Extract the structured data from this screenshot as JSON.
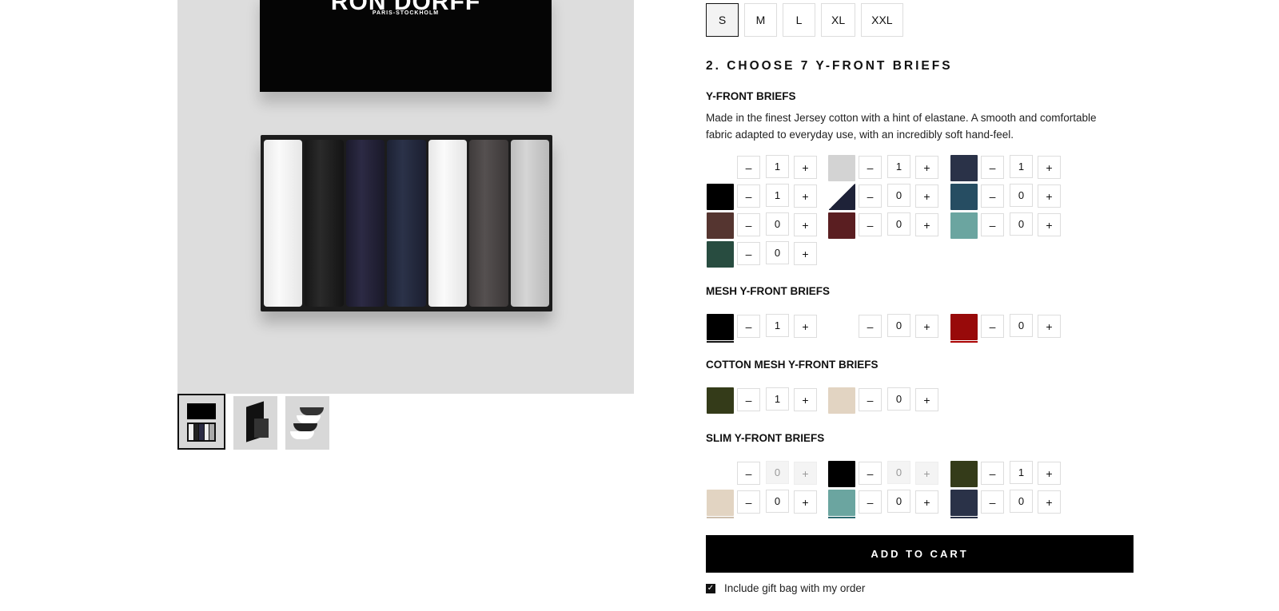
{
  "gallery": {
    "brand": "RON DORFF",
    "brand_sub": "PARIS-STOCKHOLM",
    "thumbnails": [
      "box-front",
      "box-open",
      "briefs-stack"
    ]
  },
  "sizes": {
    "options": [
      "S",
      "M",
      "L",
      "XL",
      "XXL"
    ],
    "selected": "S"
  },
  "step2": {
    "title": "2. CHOOSE 7 Y-FRONT BRIEFS"
  },
  "categories": {
    "yfront": {
      "title": "Y-FRONT BRIEFS",
      "description": "Made in the finest Jersey cotton with a hint of elastane. A smooth and comfortable fabric adapted to everyday use, with an incredibly soft hand-feel.",
      "items": [
        {
          "color": "#ffffff",
          "qty": "1"
        },
        {
          "color": "#d3d3d3",
          "qty": "1"
        },
        {
          "color": "#2a3248",
          "qty": "1"
        },
        {
          "color": "#000000",
          "qty": "1"
        },
        {
          "color": "navy-white-split",
          "qty": "0"
        },
        {
          "color": "#264d62",
          "qty": "0"
        },
        {
          "color": "#553530",
          "qty": "0"
        },
        {
          "color": "#5a1e21",
          "qty": "0"
        },
        {
          "color": "#6ba5a0",
          "qty": "0"
        },
        {
          "color": "#284c40",
          "qty": "0"
        }
      ]
    },
    "mesh": {
      "title": "MESH Y-FRONT BRIEFS",
      "items": [
        {
          "color": "#000000",
          "qty": "1"
        },
        {
          "color": "#ffffff",
          "qty": "0"
        },
        {
          "color": "#980a0a",
          "qty": "0"
        }
      ]
    },
    "cotton_mesh": {
      "title": "COTTON MESH Y-FRONT BRIEFS",
      "items": [
        {
          "color": "#343b19",
          "qty": "1"
        },
        {
          "color": "#e2d4c2",
          "qty": "0"
        }
      ]
    },
    "slim": {
      "title": "SLIM Y-FRONT BRIEFS",
      "items": [
        {
          "color": "#ffffff",
          "qty": "0"
        },
        {
          "color": "#000000",
          "qty": "0"
        },
        {
          "color": "#343b19",
          "qty": "1"
        },
        {
          "color": "#e2d4c2",
          "qty": "0"
        },
        {
          "color": "#6ba5a0",
          "qty": "0"
        },
        {
          "color": "#2a3248",
          "qty": "0"
        }
      ]
    }
  },
  "controls": {
    "minus": "–",
    "plus": "+"
  },
  "cart": {
    "add_label": "ADD TO CART",
    "gift_label": "Include gift bag with my order",
    "gift_checked": "✓"
  }
}
